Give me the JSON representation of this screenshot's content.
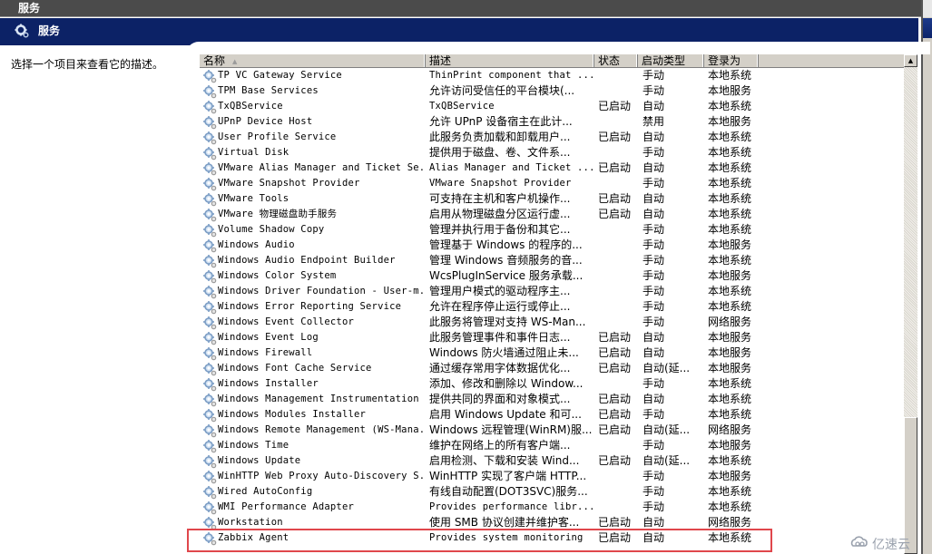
{
  "window": {
    "title": "服务"
  },
  "header": {
    "title": "服务",
    "icon": "gear-icon"
  },
  "left_pane": {
    "description_prompt": "选择一个项目来查看它的描述。"
  },
  "table": {
    "columns": [
      {
        "key": "name",
        "label": "名称",
        "sorted": "ascending"
      },
      {
        "key": "description",
        "label": "描述"
      },
      {
        "key": "status",
        "label": "状态"
      },
      {
        "key": "startup",
        "label": "启动类型"
      },
      {
        "key": "logon",
        "label": "登录为"
      }
    ],
    "rows": [
      {
        "name": "TP VC Gateway Service",
        "description": "ThinPrint component that ...",
        "status": "",
        "startup": "手动",
        "logon": "本地系统"
      },
      {
        "name": "TPM Base Services",
        "description": "允许访问受信任的平台模块(...",
        "status": "",
        "startup": "手动",
        "logon": "本地服务"
      },
      {
        "name": "TxQBService",
        "description": "TxQBService",
        "status": "已启动",
        "startup": "自动",
        "logon": "本地系统"
      },
      {
        "name": "UPnP Device Host",
        "description": "允许 UPnP 设备宿主在此计...",
        "status": "",
        "startup": "禁用",
        "logon": "本地服务"
      },
      {
        "name": "User Profile Service",
        "description": "此服务负责加载和卸载用户...",
        "status": "已启动",
        "startup": "自动",
        "logon": "本地系统"
      },
      {
        "name": "Virtual Disk",
        "description": "提供用于磁盘、卷、文件系...",
        "status": "",
        "startup": "手动",
        "logon": "本地系统"
      },
      {
        "name": "VMware Alias Manager and Ticket Se...",
        "description": "Alias Manager and Ticket ...",
        "status": "已启动",
        "startup": "自动",
        "logon": "本地系统"
      },
      {
        "name": "VMware Snapshot Provider",
        "description": "VMware Snapshot Provider",
        "status": "",
        "startup": "手动",
        "logon": "本地系统"
      },
      {
        "name": "VMware Tools",
        "description": "可支持在主机和客户机操作...",
        "status": "已启动",
        "startup": "自动",
        "logon": "本地系统"
      },
      {
        "name": "VMware 物理磁盘助手服务",
        "description": "启用从物理磁盘分区运行虚...",
        "status": "已启动",
        "startup": "自动",
        "logon": "本地系统"
      },
      {
        "name": "Volume Shadow Copy",
        "description": "管理并执行用于备份和其它...",
        "status": "",
        "startup": "手动",
        "logon": "本地系统"
      },
      {
        "name": "Windows Audio",
        "description": "管理基于 Windows 的程序的...",
        "status": "",
        "startup": "手动",
        "logon": "本地服务"
      },
      {
        "name": "Windows Audio Endpoint Builder",
        "description": "管理 Windows 音频服务的音...",
        "status": "",
        "startup": "手动",
        "logon": "本地系统"
      },
      {
        "name": "Windows Color System",
        "description": "WcsPlugInService 服务承载...",
        "status": "",
        "startup": "手动",
        "logon": "本地服务"
      },
      {
        "name": "Windows Driver Foundation - User-m...",
        "description": "管理用户模式的驱动程序主...",
        "status": "",
        "startup": "手动",
        "logon": "本地系统"
      },
      {
        "name": "Windows Error Reporting Service",
        "description": "允许在程序停止运行或停止...",
        "status": "",
        "startup": "手动",
        "logon": "本地系统"
      },
      {
        "name": "Windows Event Collector",
        "description": "此服务将管理对支持 WS-Man...",
        "status": "",
        "startup": "手动",
        "logon": "网络服务"
      },
      {
        "name": "Windows Event Log",
        "description": "此服务管理事件和事件日志...",
        "status": "已启动",
        "startup": "自动",
        "logon": "本地服务"
      },
      {
        "name": "Windows Firewall",
        "description": "Windows 防火墙通过阻止未...",
        "status": "已启动",
        "startup": "自动",
        "logon": "本地服务"
      },
      {
        "name": "Windows Font Cache Service",
        "description": "通过缓存常用字体数据优化...",
        "status": "已启动",
        "startup": "自动(延...",
        "logon": "本地服务"
      },
      {
        "name": "Windows Installer",
        "description": "添加、修改和删除以 Window...",
        "status": "",
        "startup": "手动",
        "logon": "本地系统"
      },
      {
        "name": "Windows Management Instrumentation",
        "description": "提供共同的界面和对象模式...",
        "status": "已启动",
        "startup": "自动",
        "logon": "本地系统"
      },
      {
        "name": "Windows Modules Installer",
        "description": "启用 Windows Update 和可...",
        "status": "已启动",
        "startup": "手动",
        "logon": "本地系统"
      },
      {
        "name": "Windows Remote Management (WS-Mana...",
        "description": "Windows 远程管理(WinRM)服...",
        "status": "已启动",
        "startup": "自动(延...",
        "logon": "网络服务"
      },
      {
        "name": "Windows Time",
        "description": "维护在网络上的所有客户端...",
        "status": "",
        "startup": "手动",
        "logon": "本地服务"
      },
      {
        "name": "Windows Update",
        "description": "启用检测、下载和安装 Wind...",
        "status": "已启动",
        "startup": "自动(延...",
        "logon": "本地系统"
      },
      {
        "name": "WinHTTP Web Proxy Auto-Discovery S...",
        "description": "WinHTTP 实现了客户端 HTTP...",
        "status": "",
        "startup": "手动",
        "logon": "本地服务"
      },
      {
        "name": "Wired AutoConfig",
        "description": "有线自动配置(DOT3SVC)服务...",
        "status": "",
        "startup": "手动",
        "logon": "本地系统"
      },
      {
        "name": "WMI Performance Adapter",
        "description": "Provides performance libr...",
        "status": "",
        "startup": "手动",
        "logon": "本地系统"
      },
      {
        "name": "Workstation",
        "description": "使用 SMB 协议创建并维护客...",
        "status": "已启动",
        "startup": "自动",
        "logon": "网络服务"
      },
      {
        "name": "Zabbix Agent",
        "description": "Provides system monitoring",
        "status": "已启动",
        "startup": "自动",
        "logon": "本地系统",
        "highlighted": true
      }
    ]
  },
  "annotation": {
    "highlight_color": "#e0474c",
    "highlighted_row": "Zabbix Agent"
  },
  "watermark": {
    "text": "亿速云"
  },
  "colors": {
    "titlebar": "#4b4b4b",
    "header": "#0c2266",
    "column_header": "#d4d0c8"
  }
}
